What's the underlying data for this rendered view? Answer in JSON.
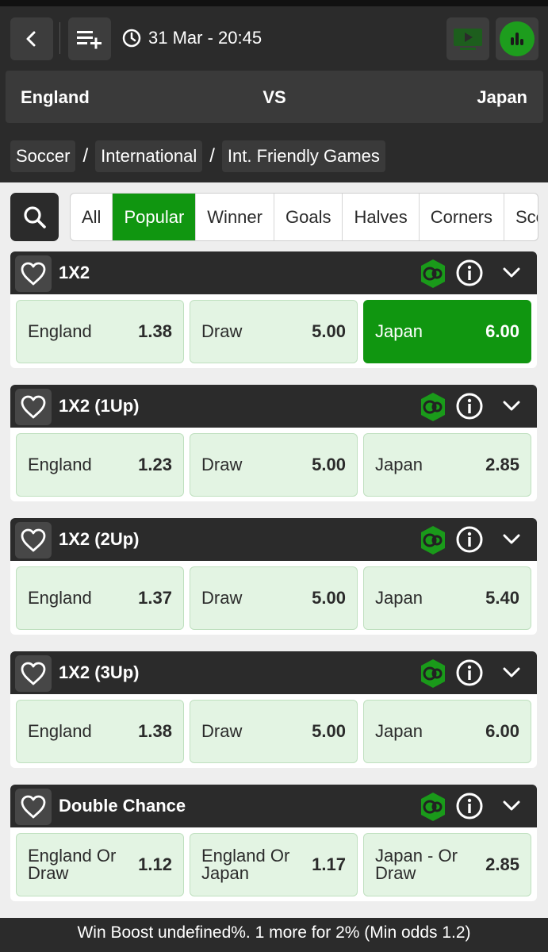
{
  "header": {
    "back_icon": "chevron-left-icon",
    "betslip_icon": "playlist-add-icon",
    "clock_icon": "clock-icon",
    "datetime": "31 Mar - 20:45",
    "tv_icon": "tv-play-icon",
    "stats_icon": "bar-chart-icon",
    "accent": "#1d9d1d"
  },
  "match": {
    "home": "England",
    "vs": "VS",
    "away": "Japan"
  },
  "breadcrumb": [
    "Soccer",
    "International",
    "Int. Friendly Games"
  ],
  "breadcrumb_sep": "/",
  "tabs": [
    "All",
    "Popular",
    "Winner",
    "Goals",
    "Halves",
    "Corners",
    "Sco"
  ],
  "active_tab": "Popular",
  "markets": [
    {
      "title": "1X2",
      "selections": [
        {
          "label": "England",
          "odds": "1.38",
          "selected": false
        },
        {
          "label": "Draw",
          "odds": "5.00",
          "selected": false
        },
        {
          "label": "Japan",
          "odds": "6.00",
          "selected": true
        }
      ]
    },
    {
      "title": "1X2 (1Up)",
      "selections": [
        {
          "label": "England",
          "odds": "1.23",
          "selected": false
        },
        {
          "label": "Draw",
          "odds": "5.00",
          "selected": false
        },
        {
          "label": "Japan",
          "odds": "2.85",
          "selected": false
        }
      ]
    },
    {
      "title": "1X2 (2Up)",
      "selections": [
        {
          "label": "England",
          "odds": "1.37",
          "selected": false
        },
        {
          "label": "Draw",
          "odds": "5.00",
          "selected": false
        },
        {
          "label": "Japan",
          "odds": "5.40",
          "selected": false
        }
      ]
    },
    {
      "title": "1X2 (3Up)",
      "selections": [
        {
          "label": "England",
          "odds": "1.38",
          "selected": false
        },
        {
          "label": "Draw",
          "odds": "5.00",
          "selected": false
        },
        {
          "label": "Japan",
          "odds": "6.00",
          "selected": false
        }
      ]
    },
    {
      "title": "Double Chance",
      "selections": [
        {
          "label": "England Or Draw",
          "odds": "1.12",
          "selected": false
        },
        {
          "label": "England Or Japan",
          "odds": "1.17",
          "selected": false
        },
        {
          "label": "Japan - Or Draw",
          "odds": "2.85",
          "selected": false
        }
      ]
    }
  ],
  "boost_text": "Win Boost undefined%. 1 more for 2% (Min odds 1.2)"
}
